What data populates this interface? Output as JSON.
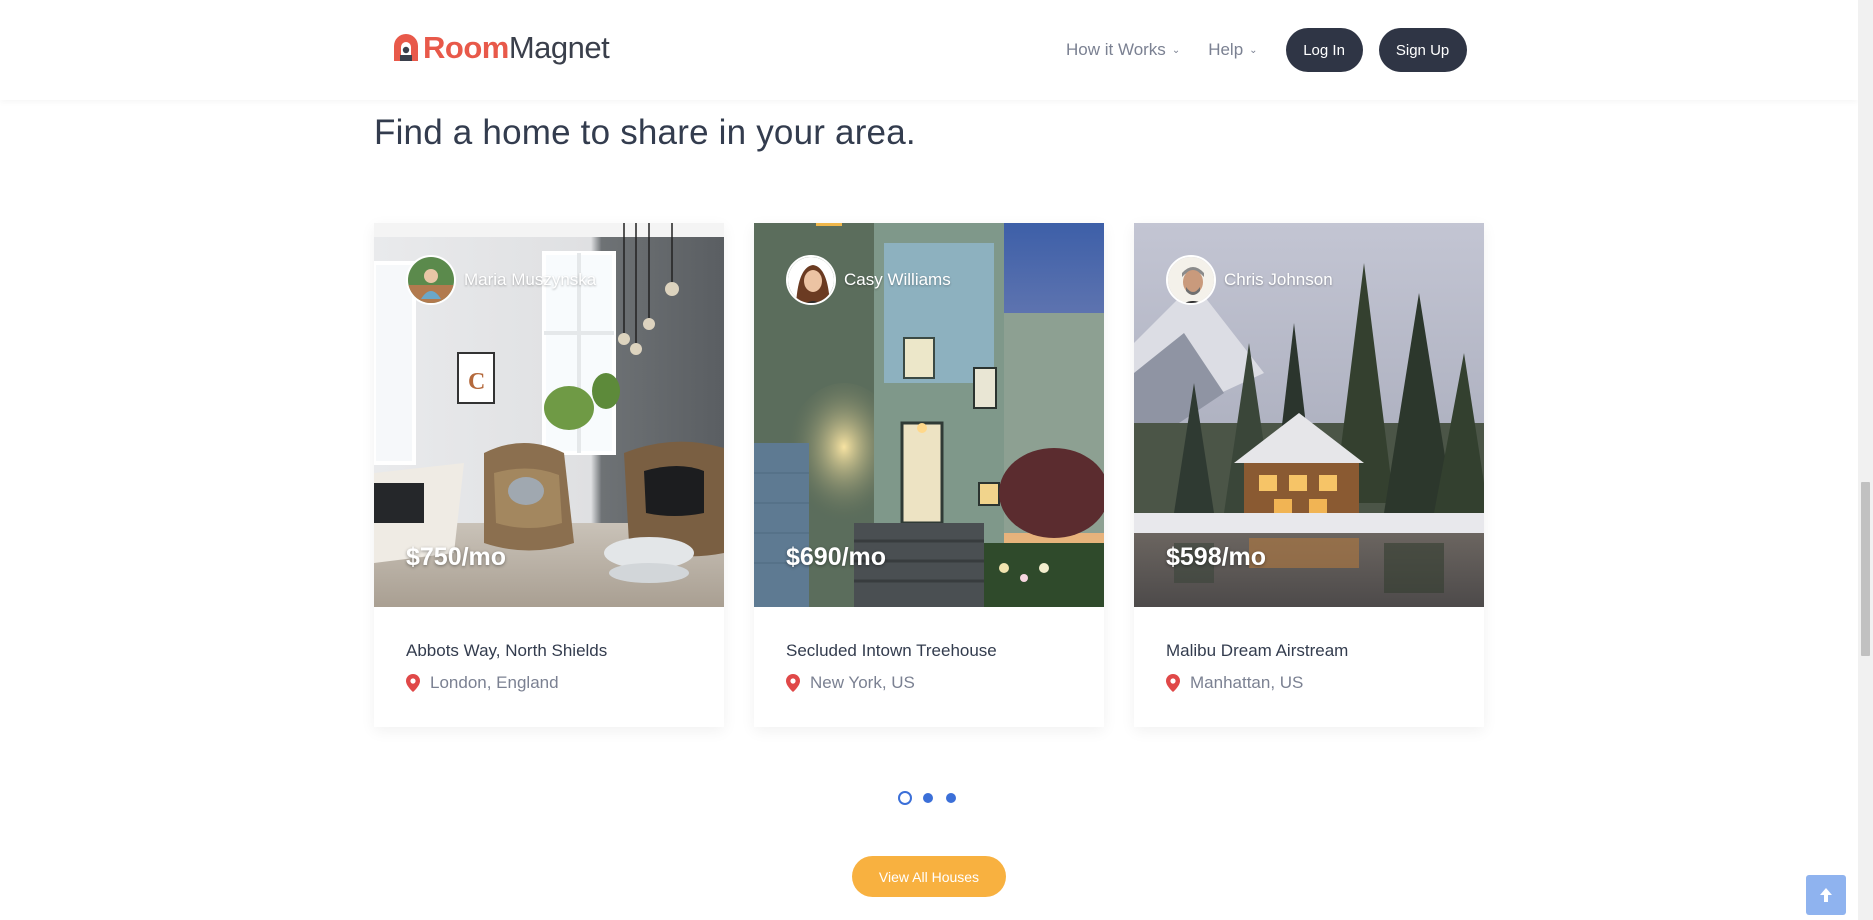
{
  "header": {
    "logo": {
      "part1": "Room",
      "part2": "Magnet"
    },
    "nav": [
      {
        "label": "How it Works",
        "icon": "chevron-down-icon"
      },
      {
        "label": "Help",
        "icon": "chevron-down-icon"
      }
    ],
    "login_label": "Log In",
    "signup_label": "Sign Up"
  },
  "main": {
    "title": "Find a home to share in your area.",
    "cards": [
      {
        "owner": "Maria Muszynska",
        "price": "$750/mo",
        "title": "Abbots Way, North Shields",
        "location": "London, England"
      },
      {
        "owner": "Casy Williams",
        "price": "$690/mo",
        "title": "Secluded Intown Treehouse",
        "location": "New York, US"
      },
      {
        "owner": "Chris Johnson",
        "price": "$598/mo",
        "title": "Malibu Dream Airstream",
        "location": "Manhattan, US"
      }
    ],
    "pager": {
      "pages": 3,
      "active": 1
    },
    "view_all_label": "View All Houses"
  },
  "colors": {
    "brand": "#e8594a",
    "dark_button": "#2f3545",
    "accent_orange": "#f8b140",
    "pager_blue": "#3b6fd8",
    "pin_red": "#e04848"
  }
}
